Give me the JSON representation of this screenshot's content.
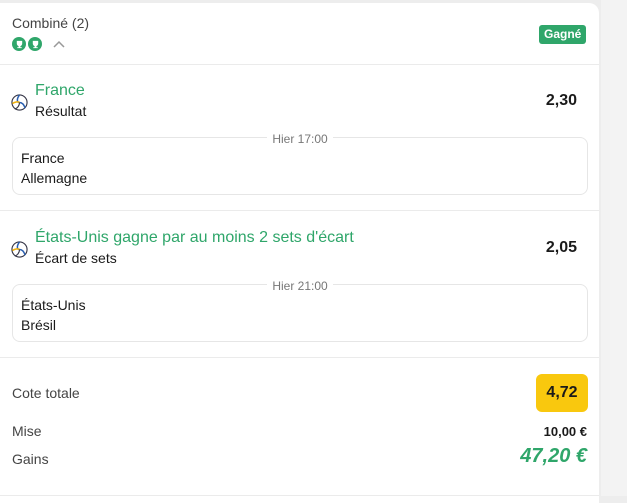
{
  "header": {
    "title": "Combiné (2)",
    "badge": "Gagné"
  },
  "icons": [
    "trophy-icon",
    "trophy-icon",
    "chevron-up-icon",
    "volleyball-icon"
  ],
  "colors": {
    "accent_green": "#2fa66a",
    "odds_highlight": "#f9c80e"
  },
  "selections": [
    {
      "pick": "France",
      "market": "Résultat",
      "odds": "2,30",
      "time": "Hier 17:00",
      "team1": "France",
      "team2": "Allemagne"
    },
    {
      "pick": "États-Unis gagne par au moins 2 sets d'écart",
      "market": "Écart de sets",
      "odds": "2,05",
      "time": "Hier 21:00",
      "team1": "États-Unis",
      "team2": "Brésil"
    }
  ],
  "summary": {
    "total_label": "Cote totale",
    "total_value": "4,72",
    "stake_label": "Mise",
    "stake_value": "10,00 €",
    "gain_label": "Gains",
    "gain_value": "47,20 €"
  }
}
